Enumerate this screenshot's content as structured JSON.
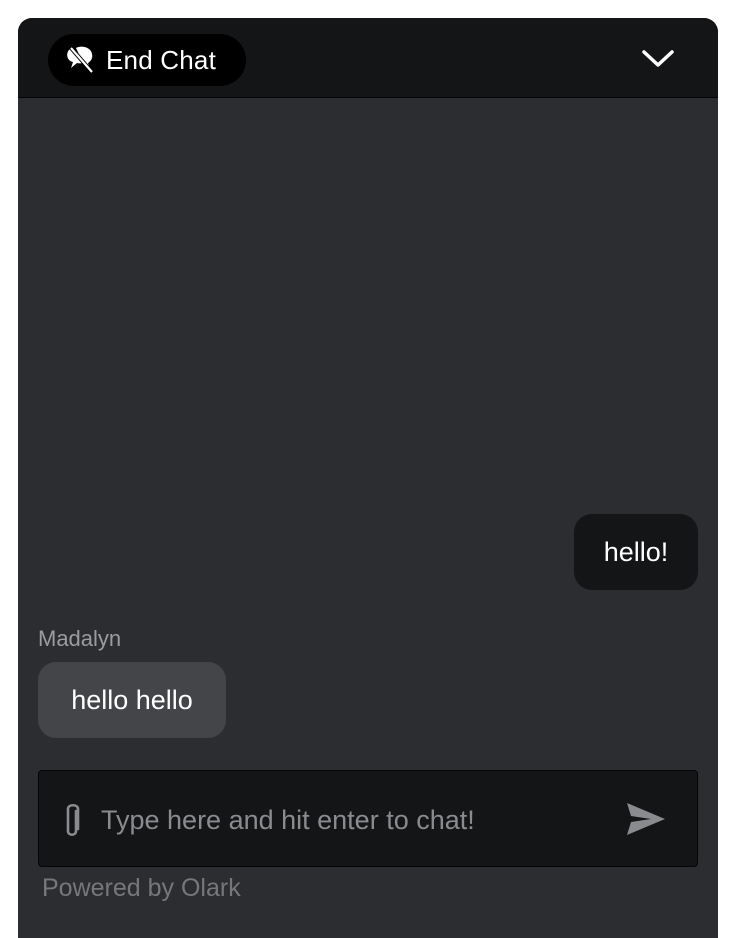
{
  "header": {
    "end_chat_label": "End Chat",
    "end_chat_icon": "chat-off-icon",
    "collapse_icon": "chevron-down-icon"
  },
  "messages": [
    {
      "from": "visitor",
      "text": "hello!"
    },
    {
      "from": "operator",
      "sender": "Madalyn",
      "text": "hello hello"
    }
  ],
  "composer": {
    "placeholder": "Type here and hit enter to chat!",
    "value": "",
    "attach_icon": "paperclip-icon",
    "send_icon": "send-icon"
  },
  "footer": {
    "powered_by": "Powered by Olark"
  },
  "colors": {
    "header_bg": "#141516",
    "body_bg": "#2c2d30",
    "visitor_bubble": "#141516",
    "operator_bubble": "#444548",
    "muted_text": "#9b9ca0"
  }
}
